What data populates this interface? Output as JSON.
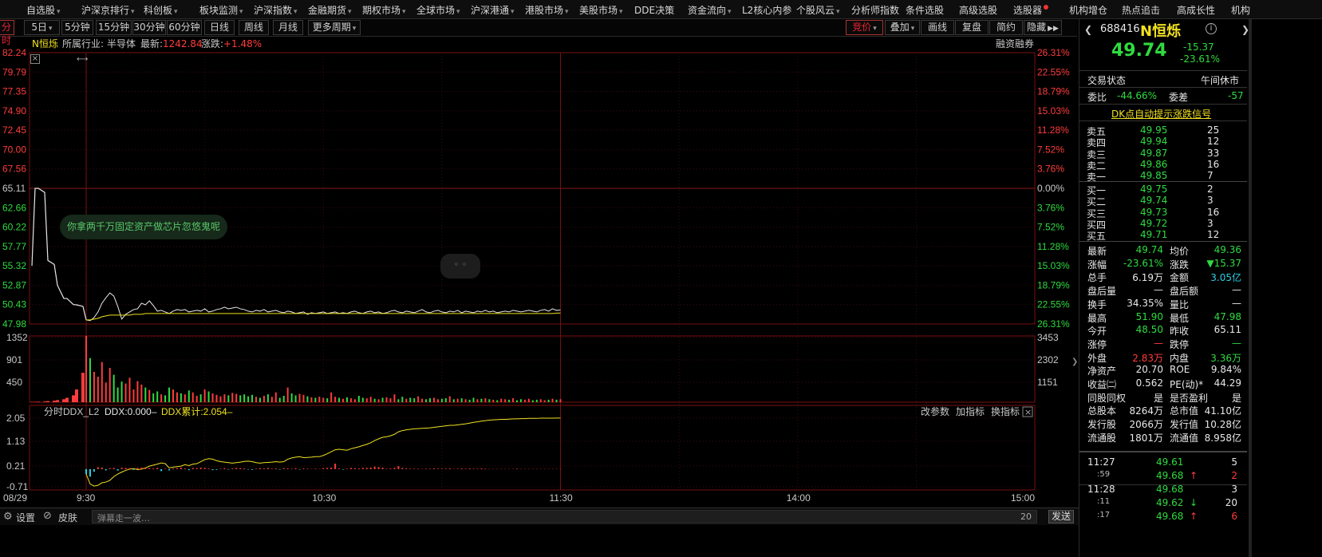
{
  "menu": [
    {
      "label": "自选股",
      "dd": true
    },
    {
      "label": "沪深京排行",
      "dd": true
    },
    {
      "label": "科创板",
      "dd": true
    },
    {
      "label": "板块监测",
      "dd": true
    },
    {
      "label": "沪深指数",
      "dd": true
    },
    {
      "label": "金融期货",
      "dd": true
    },
    {
      "label": "期权市场",
      "dd": true
    },
    {
      "label": "全球市场",
      "dd": true
    },
    {
      "label": "沪深港通",
      "dd": true
    },
    {
      "label": "港股市场",
      "dd": true
    },
    {
      "label": "美股市场",
      "dd": true
    },
    {
      "label": "DDE决策",
      "dd": false
    },
    {
      "label": "资金流向",
      "dd": true
    },
    {
      "label": "L2核心内参",
      "dd": false
    },
    {
      "label": "个股风云",
      "dd": true
    },
    {
      "label": "分析师指数",
      "dd": false
    },
    {
      "label": "条件选股",
      "dd": false
    },
    {
      "label": "高级选股",
      "dd": false
    },
    {
      "label": "选股器",
      "dd": false,
      "dot": true
    },
    {
      "label": "机构增仓",
      "dd": false
    },
    {
      "label": "热点追击",
      "dd": false
    },
    {
      "label": "高成长性",
      "dd": false
    },
    {
      "label": "机构",
      "dd": false
    }
  ],
  "toolbar": {
    "left": [
      "分时",
      "5日",
      "5分钟",
      "15分钟",
      "30分钟",
      "60分钟",
      "日线",
      "周线",
      "月线",
      "更多周期"
    ],
    "right": [
      "竞价",
      "叠加",
      "画线",
      "复盘",
      "简约",
      "隐藏"
    ]
  },
  "info": {
    "name": "N恒烁",
    "industry_label": "所属行业:",
    "industry": "半导体",
    "latest_label": "最新:",
    "latest": "1242.84",
    "change_label": "涨跌:",
    "change": "+1.48%",
    "margin": "融资融券"
  },
  "price_axis": {
    "left": [
      "82.24",
      "79.79",
      "77.35",
      "74.90",
      "72.45",
      "70.00",
      "67.56",
      "65.11",
      "62.66",
      "60.22",
      "57.77",
      "55.32",
      "52.87",
      "50.43",
      "47.98"
    ],
    "right": [
      "26.31%",
      "22.55%",
      "18.79%",
      "15.03%",
      "11.28%",
      "7.52%",
      "3.76%",
      "0.00%",
      "3.76%",
      "7.52%",
      "11.28%",
      "15.03%",
      "18.79%",
      "22.55%",
      "26.31%"
    ]
  },
  "volume_axis": {
    "left": [
      "1352",
      "901",
      "450"
    ],
    "right": [
      "3453",
      "2302",
      "1151"
    ]
  },
  "ddx": {
    "title": "分时DDX_L2",
    "ddx_label": "DDX:0.000–",
    "ddx_acc": "DDX累计:2.054–",
    "buttons": [
      "改参数",
      "加指标",
      "换指标"
    ],
    "axis": [
      "2.05",
      "1.13",
      "0.21",
      "-0.71"
    ]
  },
  "time_axis": [
    "08/29",
    "9:30",
    "10:30",
    "11:30",
    "14:00",
    "15:00"
  ],
  "comment": "你拿两千万固定资产做芯片忽悠鬼呢",
  "bottom": {
    "settings": "设置",
    "skin": "皮肤",
    "danmu_placeholder": "弹幕走一波…",
    "count": "20",
    "send": "发送"
  },
  "stock": {
    "code": "688416",
    "name": "N恒烁",
    "price": "49.74",
    "change": "-15.37",
    "change_pct": "-23.61%",
    "status_label": "交易状态",
    "status": "午间休市",
    "weibi_label": "委比",
    "weibi": "-44.66%",
    "weicha_label": "委差",
    "weicha": "-57",
    "dk_link": "DK点自动提示涨跌信号",
    "asks": [
      {
        "l": "卖五",
        "p": "49.95",
        "v": "25"
      },
      {
        "l": "卖四",
        "p": "49.94",
        "v": "12"
      },
      {
        "l": "卖三",
        "p": "49.87",
        "v": "33"
      },
      {
        "l": "卖二",
        "p": "49.86",
        "v": "16"
      },
      {
        "l": "卖一",
        "p": "49.85",
        "v": "7"
      }
    ],
    "bids": [
      {
        "l": "买一",
        "p": "49.75",
        "v": "2"
      },
      {
        "l": "买二",
        "p": "49.74",
        "v": "3"
      },
      {
        "l": "买三",
        "p": "49.73",
        "v": "16"
      },
      {
        "l": "买四",
        "p": "49.72",
        "v": "3"
      },
      {
        "l": "买五",
        "p": "49.71",
        "v": "12"
      }
    ],
    "stats": [
      {
        "l1": "最新",
        "v1": "49.74",
        "c1": "green",
        "l2": "均价",
        "v2": "49.36",
        "c2": "green"
      },
      {
        "l1": "涨幅",
        "v1": "-23.61%",
        "c1": "green",
        "l2": "涨跌",
        "v2": "▼15.37",
        "c2": "green"
      },
      {
        "l1": "总手",
        "v1": "6.19万",
        "c1": "white",
        "l2": "金额",
        "v2": "3.05亿",
        "c2": "cyan"
      },
      {
        "l1": "盘后量",
        "v1": "—",
        "c1": "white",
        "l2": "盘后额",
        "v2": "—",
        "c2": "white"
      },
      {
        "l1": "换手",
        "v1": "34.35%",
        "c1": "white",
        "l2": "量比",
        "v2": "—",
        "c2": "white"
      },
      {
        "l1": "最高",
        "v1": "51.90",
        "c1": "green",
        "l2": "最低",
        "v2": "47.98",
        "c2": "green"
      },
      {
        "l1": "今开",
        "v1": "48.50",
        "c1": "green",
        "l2": "昨收",
        "v2": "65.11",
        "c2": "white"
      },
      {
        "l1": "涨停",
        "v1": "—",
        "c1": "red",
        "l2": "跌停",
        "v2": "—",
        "c2": "green"
      },
      {
        "l1": "外盘",
        "v1": "2.83万",
        "c1": "red",
        "l2": "内盘",
        "v2": "3.36万",
        "c2": "green"
      },
      {
        "l1": "净资产",
        "v1": "20.70",
        "c1": "white",
        "l2": "ROE",
        "v2": "9.84%",
        "c2": "white"
      },
      {
        "l1": "收益㈡",
        "v1": "0.562",
        "c1": "white",
        "l2": "PE(动)*",
        "v2": "44.29",
        "c2": "white"
      },
      {
        "l1": "同股同权",
        "v1": "是",
        "c1": "white",
        "l2": "是否盈利",
        "v2": "是",
        "c2": "white"
      },
      {
        "l1": "总股本",
        "v1": "8264万",
        "c1": "white",
        "l2": "总市值",
        "v2": "41.10亿",
        "c2": "white"
      },
      {
        "l1": "发行股",
        "v1": "2066万",
        "c1": "white",
        "l2": "发行值",
        "v2": "10.28亿",
        "c2": "white"
      },
      {
        "l1": "流通股",
        "v1": "1801万",
        "c1": "white",
        "l2": "流通值",
        "v2": "8.958亿",
        "c2": "white"
      }
    ],
    "ticks": [
      {
        "t": "11:27",
        "p": "49.61",
        "arrow": "",
        "v": "5"
      },
      {
        "t": ":59",
        "p": "49.68",
        "arrow": "↑",
        "v": "2"
      },
      {
        "t": "11:28",
        "p": "49.68",
        "arrow": "",
        "v": "3"
      },
      {
        "t": ":11",
        "p": "49.62",
        "arrow": "↓",
        "v": "20"
      },
      {
        "t": ":17",
        "p": "49.68",
        "arrow": "↑",
        "v": "6"
      }
    ]
  },
  "chart_data": {
    "type": "line",
    "title": "N恒烁",
    "ylim": [
      47.98,
      82.24
    ],
    "prev_close": 65.11,
    "x": [
      0,
      1,
      2,
      3,
      4,
      5,
      6,
      7,
      8,
      9,
      10,
      11,
      12,
      13,
      14,
      15,
      16,
      17,
      18,
      19,
      20,
      21,
      22,
      23,
      24,
      25,
      26,
      27,
      28,
      29,
      30,
      31,
      32,
      33,
      34,
      35,
      36,
      37,
      38,
      39,
      40,
      41,
      42,
      43,
      44,
      45,
      46,
      47,
      48,
      49,
      50,
      51,
      52,
      53,
      54,
      55,
      56,
      57,
      58,
      59,
      60,
      61,
      62,
      63,
      64,
      65,
      66,
      67,
      68,
      69,
      70,
      71,
      72,
      73,
      74,
      75,
      76,
      77,
      78,
      79,
      80,
      81,
      82,
      83,
      84,
      85,
      86,
      87,
      88,
      89,
      90,
      91,
      92,
      93,
      94,
      95,
      96,
      97,
      98,
      99,
      100,
      101,
      102,
      103,
      104,
      105,
      106,
      107,
      108,
      109,
      110,
      111,
      112,
      113,
      114,
      115,
      116,
      117,
      118,
      119,
      120
    ],
    "pre_open": {
      "x": [
        -17,
        -16,
        -15,
        -13,
        -12,
        -10,
        -9,
        -7,
        -6,
        -4,
        -3,
        -1,
        0
      ],
      "price": [
        55.32,
        65.11,
        65.11,
        64.6,
        56.0,
        55.5,
        52.87,
        51.2,
        51.2,
        50.43,
        50.4,
        50.2,
        48.5
      ],
      "volume": [
        6,
        8,
        10,
        14,
        22,
        30,
        42,
        60,
        90,
        140,
        260,
        600,
        1352
      ]
    },
    "series": [
      {
        "name": "price",
        "values": [
          48.5,
          48.4,
          48.8,
          49.5,
          50.6,
          51.3,
          51.9,
          51.5,
          50.2,
          48.6,
          49.2,
          49.5,
          49.8,
          49.9,
          50.6,
          50.4,
          50.9,
          50.3,
          49.6,
          49.7,
          49.5,
          49.3,
          49.6,
          49.8,
          49.7,
          49.8,
          49.5,
          49.6,
          49.7,
          49.6,
          49.9,
          49.5,
          49.6,
          49.8,
          49.9,
          50.1,
          49.9,
          50.0,
          50.1,
          49.9,
          49.8,
          49.6,
          49.5,
          49.7,
          49.6,
          49.8,
          49.5,
          49.6,
          49.7,
          49.5,
          49.4,
          49.6,
          49.5,
          49.3,
          49.4,
          49.5,
          49.2,
          49.4,
          49.3,
          49.4,
          49.5,
          49.3,
          49.4,
          49.5,
          49.3,
          49.4,
          49.3,
          49.5,
          49.6,
          49.4,
          49.3,
          49.5,
          49.6,
          49.4,
          49.5,
          49.3,
          49.4,
          49.6,
          49.7,
          49.5,
          49.4,
          49.6,
          49.5,
          49.4,
          49.6,
          49.8,
          49.5,
          49.4,
          49.6,
          49.7,
          49.5,
          49.4,
          49.6,
          49.5,
          49.7,
          49.4,
          49.6,
          49.5,
          49.4,
          49.6,
          49.5,
          49.7,
          49.5,
          49.6,
          49.4,
          49.5,
          49.6,
          49.5,
          49.7,
          49.6,
          49.5,
          49.6,
          49.7,
          49.6,
          49.5,
          49.7,
          49.8,
          49.6,
          49.9,
          49.7,
          49.74
        ]
      },
      {
        "name": "avg",
        "values": [
          48.5,
          48.5,
          48.6,
          48.7,
          48.9,
          49.0,
          49.1,
          49.1,
          49.1,
          49.1,
          49.1,
          49.1,
          49.2,
          49.2,
          49.2,
          49.3,
          49.3,
          49.3,
          49.3,
          49.3,
          49.3,
          49.3,
          49.3,
          49.3,
          49.3,
          49.3,
          49.3,
          49.3,
          49.3,
          49.3,
          49.3,
          49.3,
          49.3,
          49.3,
          49.3,
          49.3,
          49.3,
          49.3,
          49.3,
          49.3,
          49.3,
          49.3,
          49.3,
          49.3,
          49.3,
          49.3,
          49.3,
          49.3,
          49.3,
          49.3,
          49.3,
          49.3,
          49.3,
          49.3,
          49.3,
          49.3,
          49.3,
          49.3,
          49.3,
          49.3,
          49.3,
          49.3,
          49.3,
          49.3,
          49.3,
          49.3,
          49.3,
          49.3,
          49.3,
          49.3,
          49.3,
          49.3,
          49.3,
          49.3,
          49.3,
          49.3,
          49.3,
          49.3,
          49.3,
          49.3,
          49.3,
          49.3,
          49.3,
          49.3,
          49.3,
          49.3,
          49.3,
          49.3,
          49.3,
          49.3,
          49.3,
          49.3,
          49.3,
          49.3,
          49.3,
          49.3,
          49.3,
          49.3,
          49.3,
          49.3,
          49.3,
          49.3,
          49.3,
          49.3,
          49.3,
          49.3,
          49.3,
          49.3,
          49.3,
          49.3,
          49.3,
          49.3,
          49.3,
          49.3,
          49.3,
          49.3,
          49.3,
          49.3,
          49.3,
          49.35,
          49.36
        ]
      },
      {
        "name": "volume",
        "values": [
          1352,
          900,
          620,
          520,
          820,
          400,
          700,
          560,
          300,
          420,
          380,
          500,
          260,
          430,
          360,
          300,
          250,
          180,
          220,
          160,
          140,
          300,
          260,
          200,
          180,
          160,
          240,
          200,
          130,
          160,
          260,
          220,
          180,
          150,
          120,
          160,
          140,
          190,
          170,
          140,
          160,
          120,
          150,
          110,
          90,
          130,
          160,
          110,
          200,
          90,
          130,
          300,
          180,
          140,
          170,
          150,
          120,
          100,
          90,
          110,
          90,
          80,
          200,
          110,
          90,
          70,
          100,
          80,
          60,
          130,
          90,
          80,
          110,
          70,
          60,
          90,
          100,
          80,
          160,
          60,
          110,
          70,
          90,
          80,
          120,
          70,
          60,
          80,
          90,
          60,
          70,
          80,
          120,
          60,
          70,
          80,
          60,
          50,
          90,
          60,
          70,
          80,
          60,
          50,
          40,
          70,
          60,
          50,
          80,
          40,
          60,
          50,
          70,
          40,
          50,
          60,
          40,
          50,
          70,
          50,
          60
        ]
      },
      {
        "name": "DDX累计",
        "values": [
          -0.2,
          -0.6,
          -0.68,
          -0.65,
          -0.55,
          -0.52,
          -0.45,
          -0.3,
          -0.2,
          -0.12,
          -0.05,
          -0.0,
          0.02,
          -0.02,
          0.0,
          0.05,
          0.12,
          0.16,
          0.2,
          0.25,
          0.22,
          0.05,
          0.08,
          0.1,
          0.12,
          0.18,
          0.14,
          0.2,
          0.22,
          0.3,
          0.38,
          0.42,
          0.4,
          0.34,
          0.3,
          0.28,
          0.26,
          0.24,
          0.26,
          0.28,
          0.31,
          0.32,
          0.3,
          0.26,
          0.24,
          0.26,
          0.27,
          0.28,
          0.3,
          0.28,
          0.3,
          0.4,
          0.45,
          0.48,
          0.5,
          0.46,
          0.47,
          0.48,
          0.5,
          0.5,
          0.55,
          0.62,
          0.7,
          0.78,
          0.8,
          0.78,
          0.76,
          0.82,
          0.86,
          0.9,
          0.95,
          1.0,
          1.06,
          1.15,
          1.22,
          1.28,
          1.3,
          1.34,
          1.4,
          1.5,
          1.55,
          1.58,
          1.6,
          1.62,
          1.63,
          1.64,
          1.65,
          1.66,
          1.68,
          1.7,
          1.72,
          1.74,
          1.76,
          1.76,
          1.78,
          1.8,
          1.82,
          1.85,
          1.88,
          1.9,
          1.93,
          1.95,
          1.97,
          1.98,
          1.99,
          2.0,
          2.0,
          2.01,
          2.02,
          2.02,
          2.03,
          2.03,
          2.04,
          2.04,
          2.04,
          2.05,
          2.05,
          2.05,
          2.05,
          2.054,
          2.054
        ]
      },
      {
        "name": "DDX",
        "values": [
          -0.2,
          -0.3,
          -0.1,
          0.08,
          0.06,
          -0.05,
          0.04,
          0.05,
          -0.06,
          0.06,
          0.05,
          0.04,
          -0.03,
          0.05,
          0.06,
          0.05,
          0.04,
          0.03,
          0.05,
          -0.08,
          0.02,
          -0.05,
          0.03,
          0.04,
          0.06,
          0.03,
          -0.04,
          0.05,
          0.04,
          0.06,
          0.05,
          0.03,
          -0.04,
          -0.03,
          0.02,
          0.04,
          -0.02,
          0.03,
          0.05,
          0.04,
          0.03,
          -0.02,
          -0.03,
          0.02,
          0.04,
          0.03,
          0.05,
          0.02,
          0.03,
          -0.02,
          0.04,
          0.03,
          0.02,
          0.04,
          -0.02,
          0.03,
          0.02,
          0.01,
          0.02,
          0.01,
          0.04,
          0.05,
          0.06,
          0.22,
          0.03,
          -0.02,
          0.02,
          0.05,
          0.04,
          0.03,
          0.05,
          0.05,
          0.06,
          0.1,
          0.08,
          0.06,
          0.02,
          0.03,
          0.05,
          0.12,
          0.05,
          0.03,
          0.02,
          0.02,
          0.02,
          0.01,
          0.02,
          0.02,
          0.03,
          0.02,
          0.02,
          0.02,
          0.03,
          0.01,
          0.02,
          0.03,
          0.02,
          0.03,
          0.02,
          0.02,
          0.03,
          0.02,
          0.01,
          0.01,
          0.01,
          0.01,
          0.01,
          0.01,
          0.01,
          0.02,
          0.01,
          0.01,
          0.01,
          0.01,
          0.01,
          0.01,
          0.01,
          0.01,
          0.01,
          0.01,
          0.01
        ]
      }
    ]
  }
}
